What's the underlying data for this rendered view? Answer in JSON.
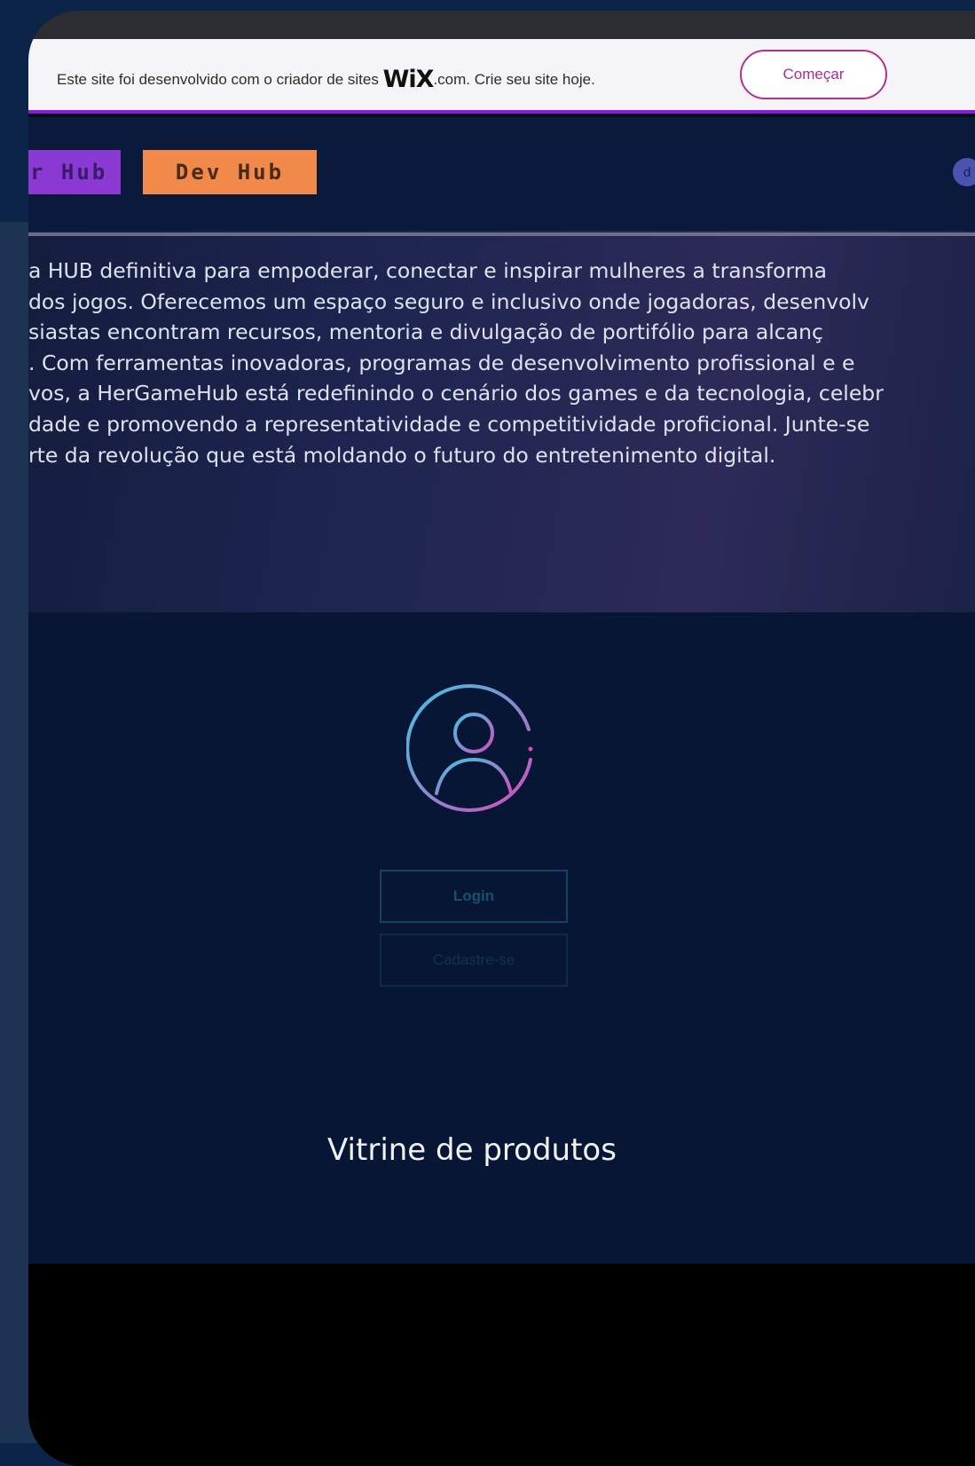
{
  "wix_banner": {
    "text_before": "Este site foi desenvolvido com o criador de sites ",
    "logo": "WiX",
    "text_after": ".com. Crie seu site hoje.",
    "cta_label": "Começar"
  },
  "header": {
    "player_hub_label": "r Hub",
    "dev_hub_label": "Dev Hub",
    "avatar_letter": "d"
  },
  "about": {
    "lines": [
      " a HUB definitiva para empoderar, conectar e inspirar mulheres a transforma",
      " dos jogos. Oferecemos um espaço seguro e inclusivo onde jogadoras, desenvolv",
      "siastas encontram recursos, mentoria e divulgação de portifólio para alcanç",
      ". Com ferramentas inovadoras, programas de desenvolvimento profissional e e",
      "vos, a HerGameHub está redefinindo o cenário dos games e da tecnologia, celebr",
      "dade e promovendo a representatividade e competitividade proficional. Junte-se",
      "rte da revolução que está moldando o futuro do entretenimento digital."
    ]
  },
  "login": {
    "login_label": "Login",
    "register_label": "Cadastre-se"
  },
  "showcase": {
    "title": "Vitrine de produtos"
  },
  "colors": {
    "player_hub": "#8a3ad2",
    "dev_hub": "#f0894a",
    "wix_accent": "#8a1bd6",
    "icon_gradient_start": "#3fc6e6",
    "icon_gradient_end": "#d04fb8"
  }
}
